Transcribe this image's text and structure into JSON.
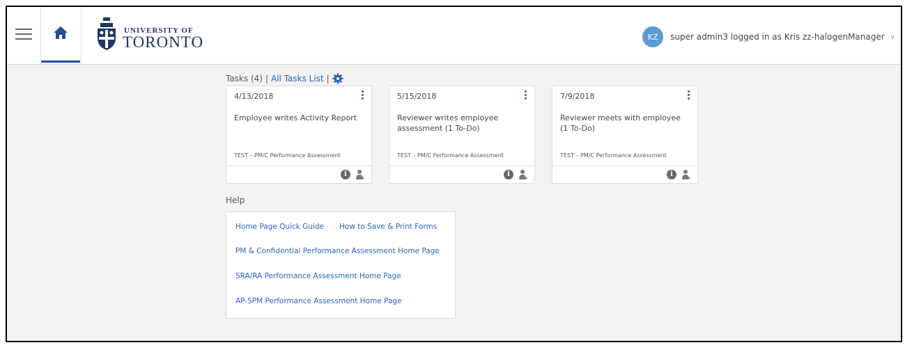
{
  "header": {
    "logo": {
      "line1": "UNIVERSITY OF",
      "line2": "TORONTO"
    },
    "user": {
      "initials": "KZ",
      "text": "super admin3 logged in as Kris zz-halogenManager"
    },
    "colors": {
      "accent": "#1f4e9b",
      "avatar": "#5b9bd5",
      "link": "#2a62b8"
    }
  },
  "tasks": {
    "label": "Tasks (4)",
    "separator": "|",
    "all_tasks_link": "All Tasks List",
    "cards": [
      {
        "date": "4/13/2018",
        "title": "Employee writes Activity Report",
        "form": "TEST – PM/C Performance Assessment"
      },
      {
        "date": "5/15/2018",
        "title": "Reviewer writes employee assessment (1 To-Do)",
        "form": "TEST – PM/C Performance Assessment"
      },
      {
        "date": "7/9/2018",
        "title": "Reviewer meets with employee (1 To-Do)",
        "form": "TEST – PM/C Performance Assessment"
      }
    ]
  },
  "help": {
    "title": "Help",
    "links": [
      "Home Page Quick Guide",
      "How to Save & Print Forms",
      "PM & Confidential Performance Assessment Home Page",
      "SRA/RA Performance Assessment Home Page",
      "AP-SPM Performance Assessment Home Page"
    ]
  }
}
